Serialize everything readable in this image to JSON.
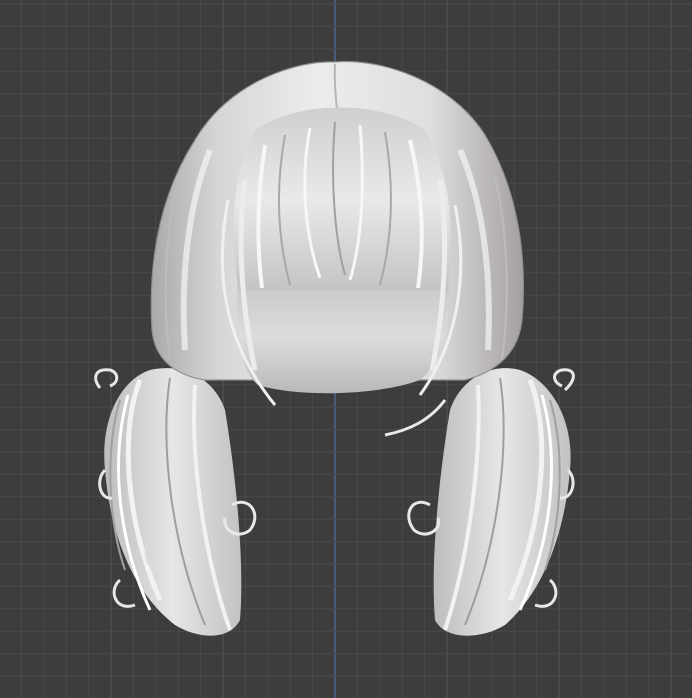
{
  "viewport": {
    "background": "#3d3d3d",
    "grid_minor": "#4a4a4a",
    "grid_major": "#555555",
    "axis_color": "#4f6fa8",
    "model_color": "#d8d8d8",
    "model_shadow": "#9a9a9a",
    "model_highlight": "#f4f4f4",
    "model": "hair-mesh"
  }
}
